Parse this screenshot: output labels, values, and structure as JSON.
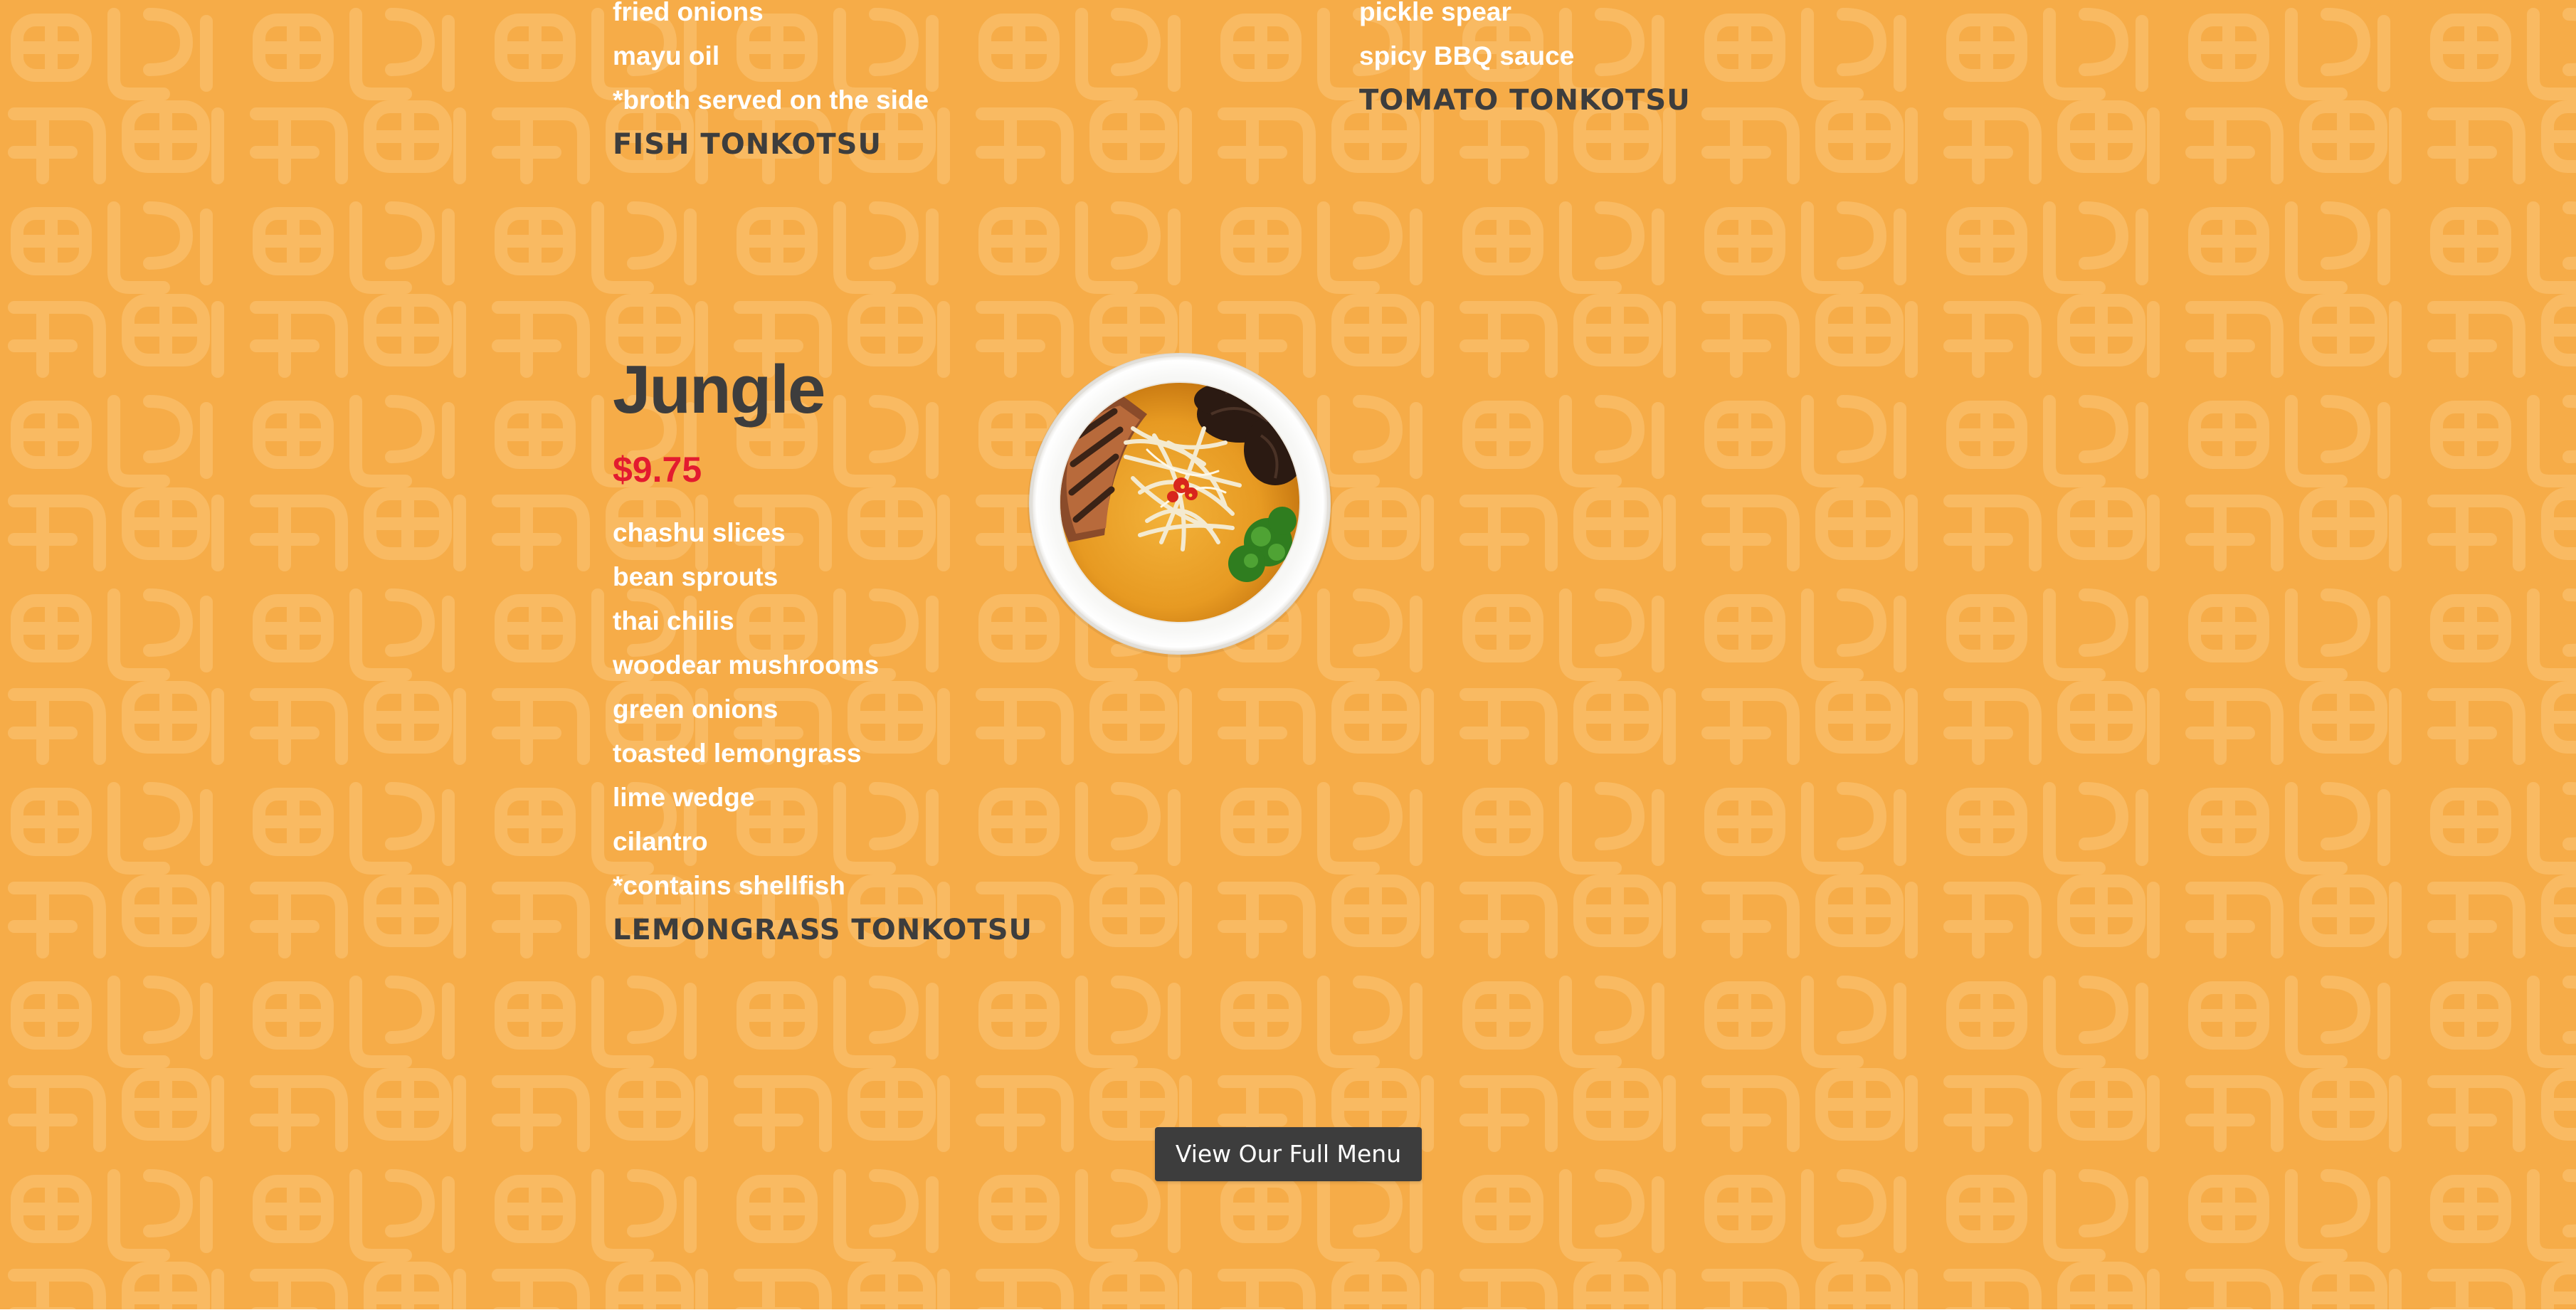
{
  "colors": {
    "background": "#F6AC48",
    "pattern": "#F9BC66",
    "heading": "#3D3D3D",
    "ingredient_text": "#FFFFFF",
    "price": "#E31B2F",
    "button_bg": "#3D3D3D",
    "button_text": "#FFFFFF"
  },
  "fish_item": {
    "ingredients": [
      "fried onions",
      "mayu oil",
      "*broth served on the side"
    ],
    "title": "FISH TONKOTSU"
  },
  "tomato_item": {
    "ingredients": [
      "pickle spear",
      "spicy BBQ sauce"
    ],
    "title": "TOMATO TONKOTSU"
  },
  "jungle_item": {
    "name": "Jungle",
    "price": "$9.75",
    "ingredients": [
      "chashu slices",
      "bean sprouts",
      "thai chilis",
      "woodear mushrooms",
      "green onions",
      "toasted lemongrass",
      "lime wedge",
      "cilantro",
      "*contains shellfish"
    ],
    "title": "LEMONGRASS TONKOTSU",
    "image_icon": "ramen-bowl-photo"
  },
  "cta": {
    "label": "View Our Full Menu"
  }
}
